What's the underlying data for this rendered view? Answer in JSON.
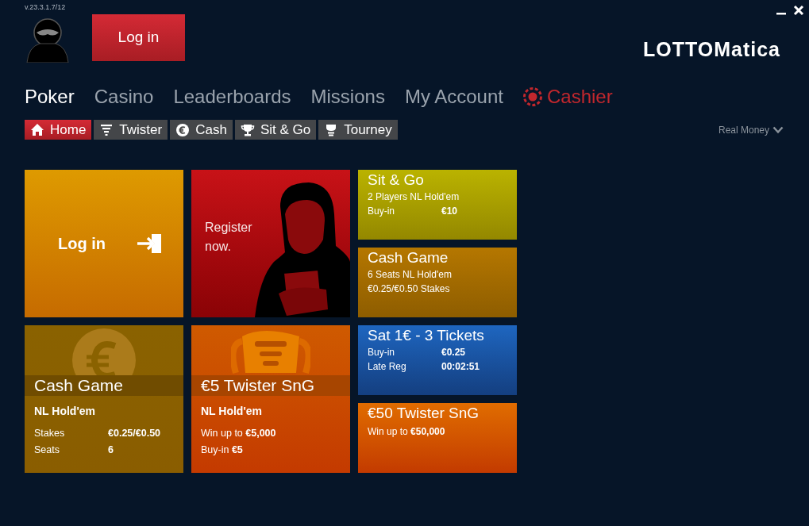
{
  "version": "v.23.3.1.7/12",
  "login_button": "Log in",
  "logo": "LOTTOMatica",
  "main_nav": [
    {
      "label": "Poker",
      "selected": true,
      "kind": "plain"
    },
    {
      "label": "Casino",
      "selected": false,
      "kind": "plain"
    },
    {
      "label": "Leaderboards",
      "selected": false,
      "kind": "plain"
    },
    {
      "label": "Missions",
      "selected": false,
      "kind": "plain"
    },
    {
      "label": "My Account",
      "selected": false,
      "kind": "plain"
    },
    {
      "label": "Cashier",
      "selected": false,
      "kind": "cashier"
    }
  ],
  "sub_tabs": [
    {
      "label": "Home",
      "selected": true,
      "kind": "home"
    },
    {
      "label": "Twister",
      "selected": false,
      "kind": "twister"
    },
    {
      "label": "Cash",
      "selected": false,
      "kind": "cash"
    },
    {
      "label": "Sit & Go",
      "selected": false,
      "kind": "sitgo"
    },
    {
      "label": "Tourney",
      "selected": false,
      "kind": "tourney"
    }
  ],
  "money_mode": "Real Money",
  "featured_tiles": [
    {
      "kind": "login",
      "label": "Log in"
    },
    {
      "kind": "register",
      "label": "Register now."
    }
  ],
  "game_cards": [
    {
      "kind": "cash",
      "title": "Cash Game",
      "subtitle": "NL Hold'em",
      "rows": [
        {
          "label": "Stakes",
          "value": "€0.25/€0.50"
        },
        {
          "label": "Seats",
          "value": "6"
        }
      ]
    },
    {
      "kind": "twister",
      "title": "€5 Twister SnG",
      "subtitle": "NL Hold'em",
      "lines": [
        "Win up to **€5,000**",
        "Buy-in **€5**"
      ]
    }
  ],
  "side_tiles": [
    {
      "kind": "sitgo",
      "title": "Sit & Go",
      "lines": [
        "2 Players NL Hold'em"
      ],
      "rows": [
        {
          "label": "Buy-in",
          "value": "€10"
        }
      ]
    },
    {
      "kind": "cash",
      "title": "Cash Game",
      "lines": [
        "6 Seats NL Hold'em",
        "€0.25/€0.50 Stakes"
      ]
    },
    {
      "kind": "satellite",
      "title": "Sat 1€ - 3 Tickets",
      "rows": [
        {
          "label": "Buy-in",
          "value": "€0.25"
        },
        {
          "label": "Late Reg",
          "value": "00:02:51"
        }
      ]
    },
    {
      "kind": "twister",
      "title": "€50 Twister SnG",
      "lines": [
        "Win up to **€50,000**"
      ]
    }
  ]
}
